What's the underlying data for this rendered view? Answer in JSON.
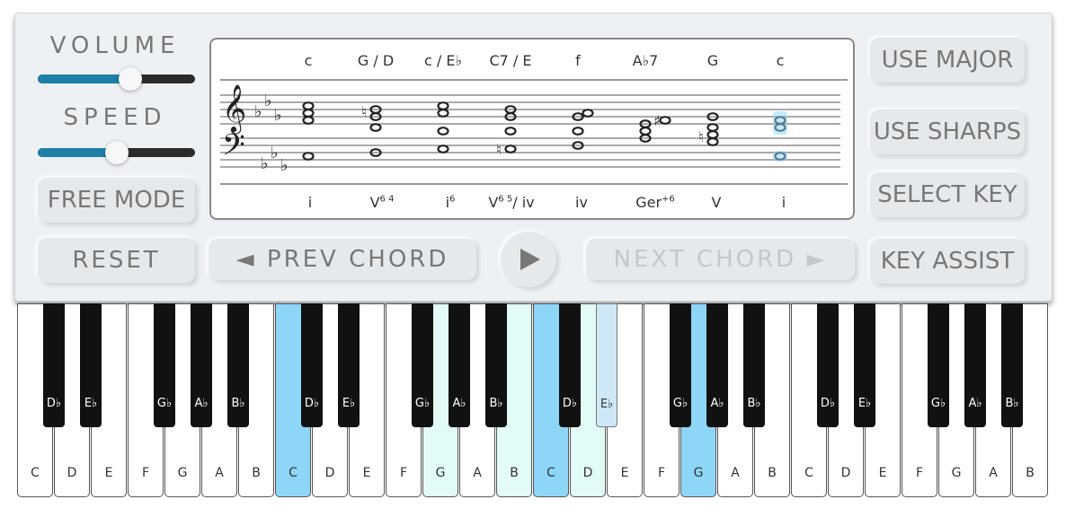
{
  "controls": {
    "volume_label": "VOLUME",
    "speed_label": "SPEED",
    "volume_level": 0.6,
    "speed_level": 0.5,
    "free_mode": "FREE MODE",
    "reset": "RESET",
    "prev_chord": "◄ PREV CHORD",
    "next_chord": "NEXT CHORD ►",
    "use_major": "USE MAJOR",
    "use_sharps": "USE SHARPS",
    "select_key": "SELECT KEY",
    "key_assist": "KEY ASSIST",
    "play_icon": "play-icon",
    "accent_color": "#1e7fa8"
  },
  "score": {
    "chord_names": [
      "c",
      "G / D",
      "c / E♭",
      "C7 / E",
      "f",
      "A♭7",
      "G",
      "c"
    ],
    "roman": [
      {
        "base": "i",
        "sup": ""
      },
      {
        "base": "V",
        "sup": "6 4"
      },
      {
        "base": "i",
        "sup": "6"
      },
      {
        "base": "V",
        "sup": "6 5",
        "tail": "/ iv"
      },
      {
        "base": "iv",
        "sup": ""
      },
      {
        "base": "Ger",
        "sup": "+6"
      },
      {
        "base": "V",
        "sup": ""
      },
      {
        "base": "i",
        "sup": ""
      }
    ]
  },
  "keyboard": {
    "white_keys": [
      "C",
      "D",
      "E",
      "F",
      "G",
      "A",
      "B",
      "C",
      "D",
      "E",
      "F",
      "G",
      "A",
      "B",
      "C",
      "D",
      "E",
      "F",
      "G",
      "A",
      "B",
      "C",
      "D",
      "E",
      "F",
      "G",
      "A",
      "B"
    ],
    "black_keys": [
      "D♭",
      "E♭",
      "G♭",
      "A♭",
      "B♭",
      "D♭",
      "E♭",
      "G♭",
      "A♭",
      "B♭",
      "D♭",
      "E♭",
      "G♭",
      "A♭",
      "B♭",
      "D♭",
      "E♭",
      "G♭",
      "A♭",
      "B♭"
    ],
    "highlight_white_blue": [
      7,
      14,
      18
    ],
    "highlight_white_mint": [
      11,
      13,
      15
    ],
    "highlight_black_light": [
      11
    ],
    "highlight_colors": {
      "blue": "#8dd6f8",
      "mint": "#e2fbf6",
      "light": "#cfe8f8"
    }
  }
}
